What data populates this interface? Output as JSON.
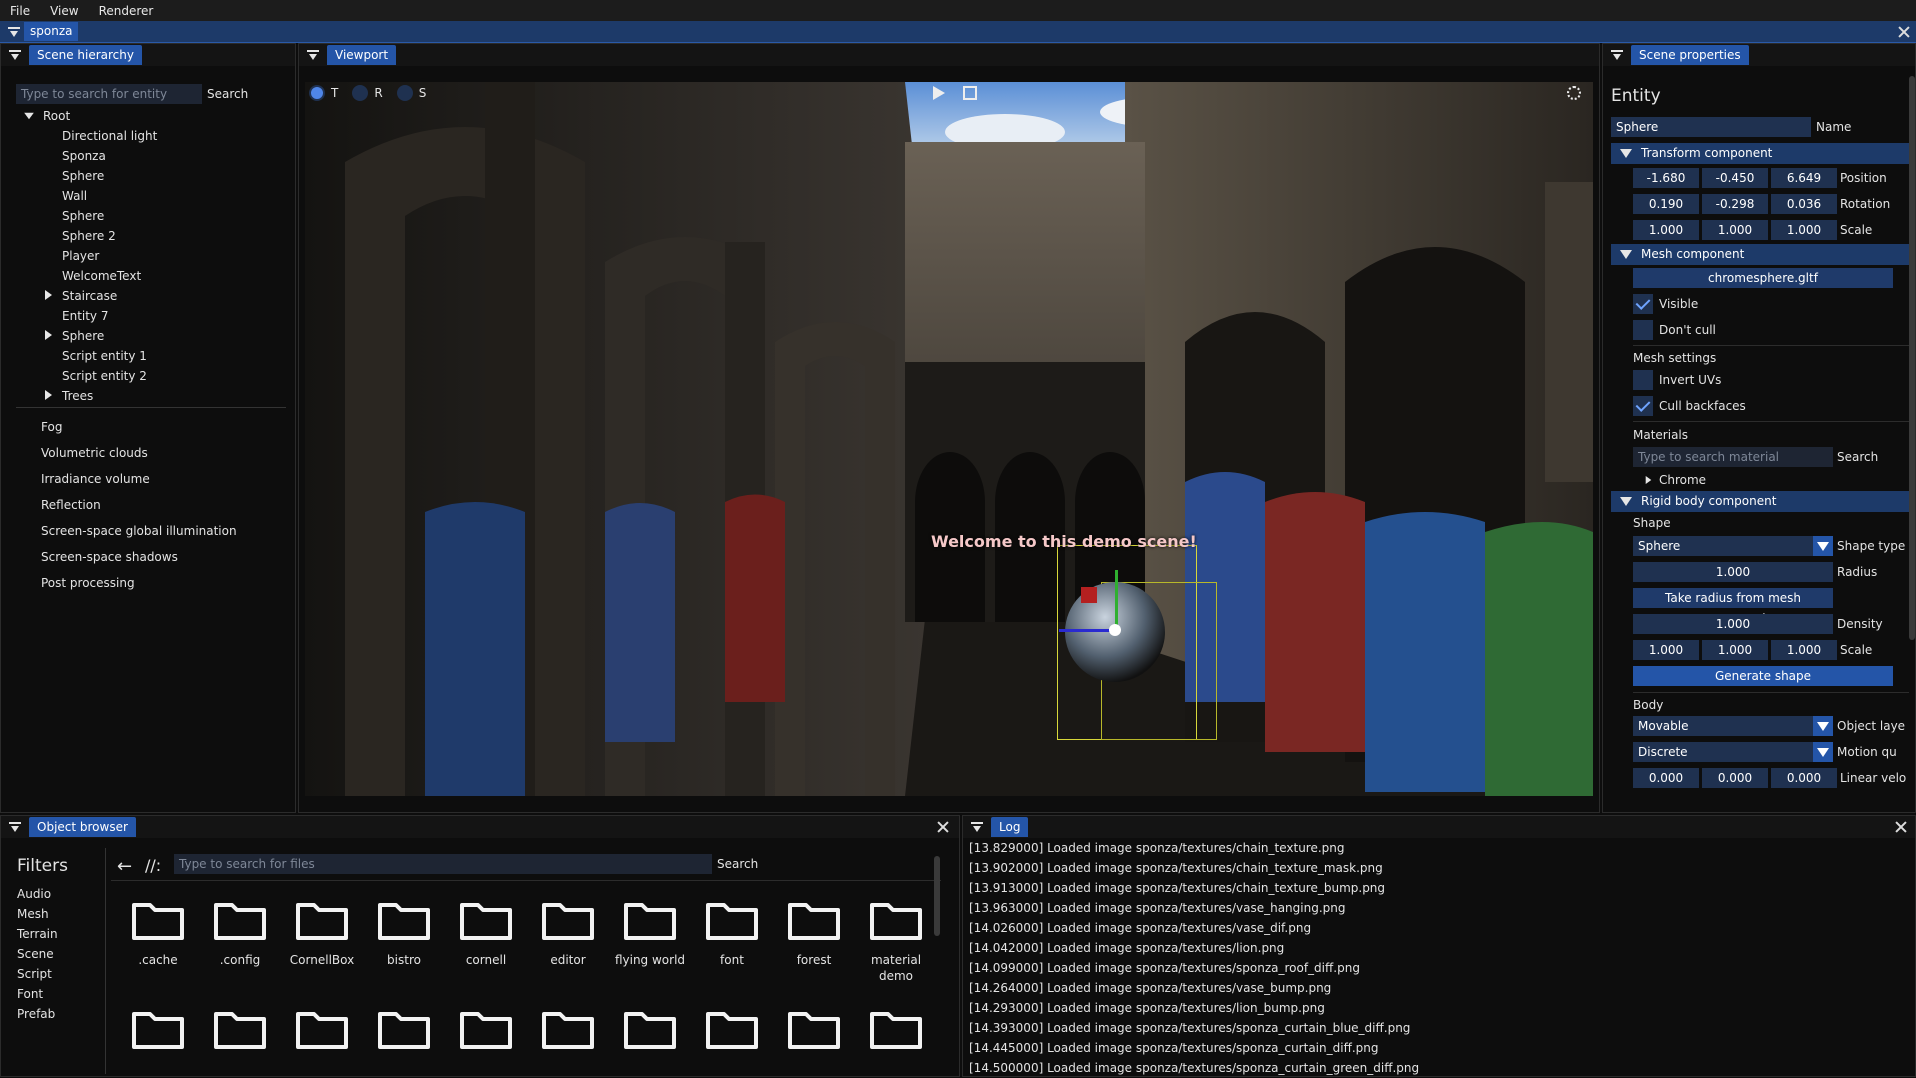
{
  "menu": [
    "File",
    "View",
    "Renderer"
  ],
  "dock_tab": "sponza",
  "hierarchy": {
    "tab": "Scene hierarchy",
    "search_placeholder": "Type to search for entity",
    "search_label": "Search",
    "root": "Root",
    "entities": [
      "Directional light",
      "Sponza",
      "Sphere",
      "Wall",
      "Sphere",
      "Sphere 2",
      "Player",
      "WelcomeText",
      "Staircase",
      "Entity 7",
      "Sphere",
      "Script entity 1",
      "Script entity 2",
      "Trees"
    ],
    "settings": [
      "Fog",
      "Volumetric clouds",
      "Irradiance volume",
      "Reflection",
      "Screen-space global illumination",
      "Screen-space shadows",
      "Post processing"
    ]
  },
  "viewport": {
    "tab": "Viewport",
    "gizmo_modes": [
      "T",
      "R",
      "S"
    ],
    "welcome_text": "Welcome to this demo scene!"
  },
  "properties": {
    "tab": "Scene properties",
    "title": "Entity",
    "name_value": "Sphere",
    "name_label": "Name",
    "transform": {
      "header": "Transform component",
      "position": [
        "-1.680",
        "-0.450",
        "6.649"
      ],
      "rotation": [
        "0.190",
        "-0.298",
        "0.036"
      ],
      "scale": [
        "1.000",
        "1.000",
        "1.000"
      ],
      "labels": [
        "Position",
        "Rotation",
        "Scale"
      ]
    },
    "mesh": {
      "header": "Mesh component",
      "file": "chromesphere.gltf",
      "visible": "Visible",
      "dont_cull": "Don't cull",
      "settings": "Mesh settings",
      "invert_uvs": "Invert UVs",
      "cull_backfaces": "Cull backfaces",
      "materials": "Materials",
      "material_placeholder": "Type to search material",
      "material_search": "Search",
      "material_item": "Chrome"
    },
    "rigid": {
      "header": "Rigid body component",
      "shape_label": "Shape",
      "shape": "Sphere",
      "shape_type": "Shape type",
      "radius": "1.000",
      "radius_label": "Radius",
      "take_radius": "Take radius from mesh component",
      "density": "1.000",
      "density_label": "Density",
      "scale": [
        "1.000",
        "1.000",
        "1.000"
      ],
      "scale_label": "Scale",
      "generate": "Generate shape",
      "body_label": "Body",
      "layer": "Movable",
      "layer_label": "Object laye",
      "motion": "Discrete",
      "motion_label": "Motion qu",
      "linear": [
        "0.000",
        "0.000",
        "0.000"
      ],
      "linear_label": "Linear velo"
    }
  },
  "browser": {
    "tab": "Object browser",
    "filters_title": "Filters",
    "filters": [
      "Audio",
      "Mesh",
      "Terrain",
      "Scene",
      "Script",
      "Font",
      "Prefab"
    ],
    "path": "//:",
    "search_placeholder": "Type to search for files",
    "search_label": "Search",
    "folders": [
      ".cache",
      ".config",
      "CornellBox",
      "bistro",
      "cornell",
      "editor",
      "flying world",
      "font",
      "forest",
      "material demo"
    ]
  },
  "log": {
    "tab": "Log",
    "lines": [
      "[13.829000] Loaded image sponza/textures/chain_texture.png",
      "[13.902000] Loaded image sponza/textures/chain_texture_mask.png",
      "[13.913000] Loaded image sponza/textures/chain_texture_bump.png",
      "[13.963000] Loaded image sponza/textures/vase_hanging.png",
      "[14.026000] Loaded image sponza/textures/vase_dif.png",
      "[14.042000] Loaded image sponza/textures/lion.png",
      "[14.099000] Loaded image sponza/textures/sponza_roof_diff.png",
      "[14.264000] Loaded image sponza/textures/vase_bump.png",
      "[14.293000] Loaded image sponza/textures/lion_bump.png",
      "[14.393000] Loaded image sponza/textures/sponza_curtain_blue_diff.png",
      "[14.445000] Loaded image sponza/textures/sponza_curtain_diff.png",
      "[14.500000] Loaded image sponza/textures/sponza_curtain_green_diff.png"
    ]
  }
}
